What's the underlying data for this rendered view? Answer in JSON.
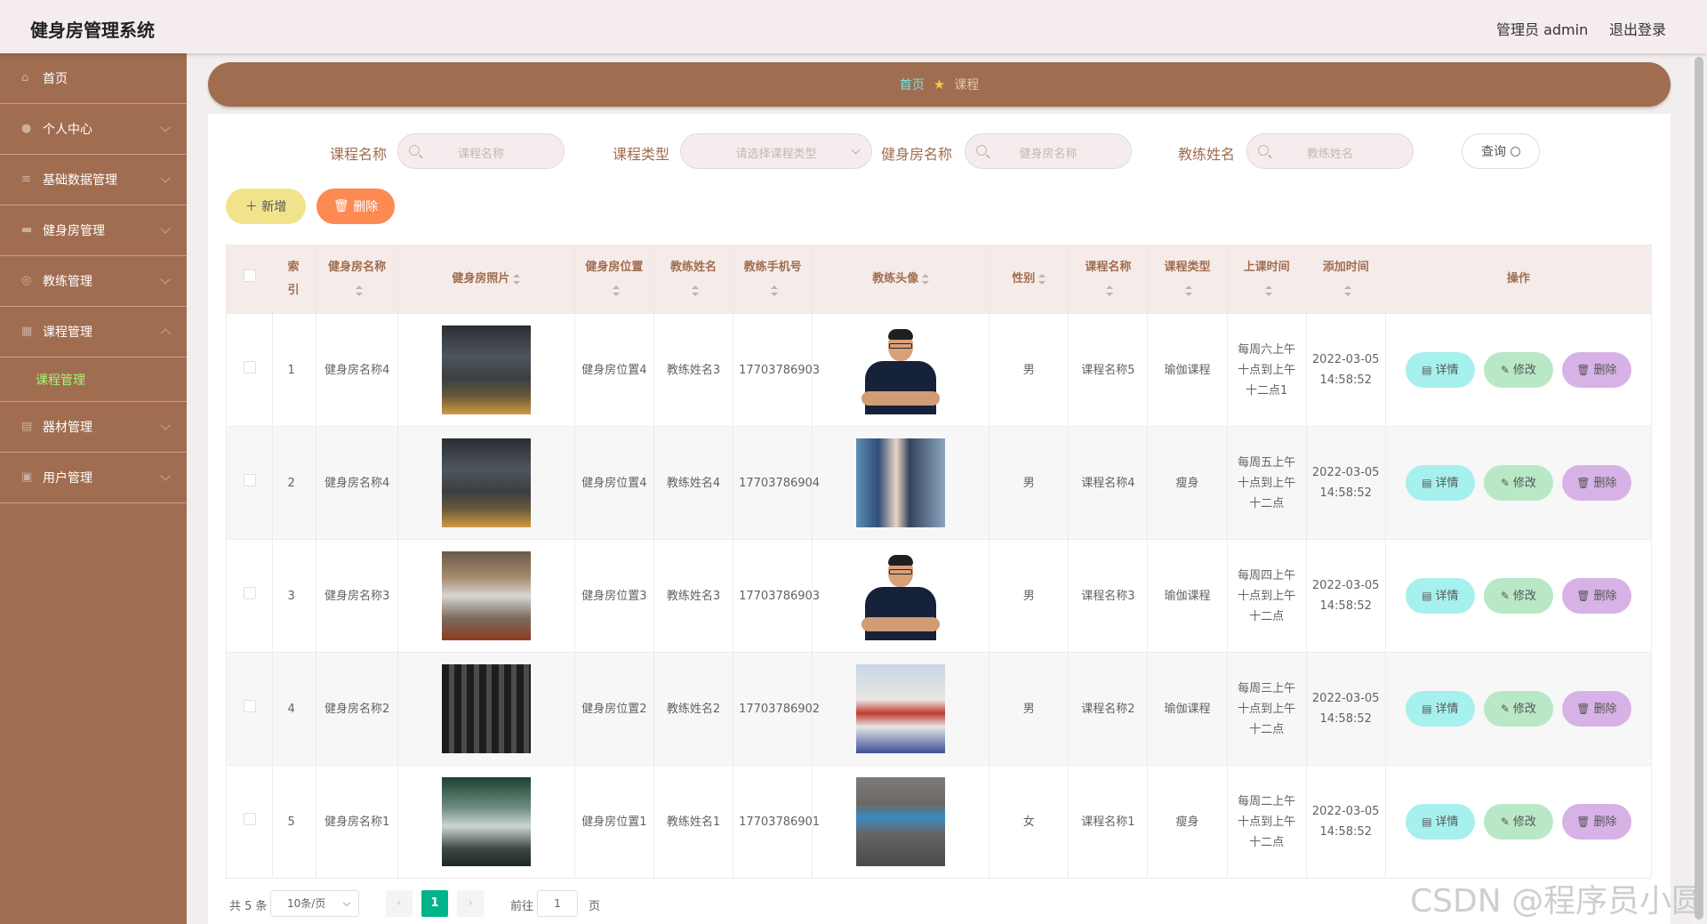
{
  "header": {
    "title": "健身房管理系统",
    "user": "管理员 admin",
    "logout": "退出登录"
  },
  "sidebar": {
    "items": [
      {
        "label": "首页",
        "icon": "home-icon"
      },
      {
        "label": "个人中心",
        "icon": "user-icon"
      },
      {
        "label": "基础数据管理",
        "icon": "menu-icon"
      },
      {
        "label": "健身房管理",
        "icon": "gym-icon"
      },
      {
        "label": "教练管理",
        "icon": "coach-icon"
      },
      {
        "label": "课程管理",
        "icon": "grid-icon"
      },
      {
        "label": "器材管理",
        "icon": "equipment-icon"
      },
      {
        "label": "用户管理",
        "icon": "users-icon"
      }
    ],
    "subitem": "课程管理"
  },
  "breadcrumb": {
    "home": "首页",
    "current": "课程"
  },
  "search": {
    "course_name_label": "课程名称",
    "course_name_placeholder": "课程名称",
    "course_type_label": "课程类型",
    "course_type_placeholder": "请选择课程类型",
    "gym_name_label": "健身房名称",
    "gym_name_placeholder": "健身房名称",
    "coach_name_label": "教练姓名",
    "coach_name_placeholder": "教练姓名",
    "query_label": "查询"
  },
  "actions": {
    "add": "新增",
    "delete": "删除"
  },
  "table": {
    "headers": {
      "index": "索引",
      "gym_name": "健身房名称",
      "gym_photo": "健身房照片",
      "gym_location": "健身房位置",
      "coach_name": "教练姓名",
      "coach_phone": "教练手机号",
      "coach_avatar": "教练头像",
      "gender": "性别",
      "course_name": "课程名称",
      "course_type": "课程类型",
      "class_time": "上课时间",
      "added_time": "添加时间",
      "operation": "操作"
    },
    "buttons": {
      "view": "详情",
      "edit": "修改",
      "delete": "删除"
    },
    "rows": [
      {
        "index": "1",
        "gym_name": "健身房名称4",
        "gym_location": "健身房位置4",
        "coach_name": "教练姓名3",
        "coach_phone": "17703786903",
        "gender": "男",
        "course_name": "课程名称5",
        "course_type": "瑜伽课程",
        "class_time": "每周六上午十点到上午十二点1",
        "added_time": "2022-03-05 14:58:52"
      },
      {
        "index": "2",
        "gym_name": "健身房名称4",
        "gym_location": "健身房位置4",
        "coach_name": "教练姓名4",
        "coach_phone": "17703786904",
        "gender": "男",
        "course_name": "课程名称4",
        "course_type": "瘦身",
        "class_time": "每周五上午十点到上午十二点",
        "added_time": "2022-03-05 14:58:52"
      },
      {
        "index": "3",
        "gym_name": "健身房名称3",
        "gym_location": "健身房位置3",
        "coach_name": "教练姓名3",
        "coach_phone": "17703786903",
        "gender": "男",
        "course_name": "课程名称3",
        "course_type": "瑜伽课程",
        "class_time": "每周四上午十点到上午十二点",
        "added_time": "2022-03-05 14:58:52"
      },
      {
        "index": "4",
        "gym_name": "健身房名称2",
        "gym_location": "健身房位置2",
        "coach_name": "教练姓名2",
        "coach_phone": "17703786902",
        "gender": "男",
        "course_name": "课程名称2",
        "course_type": "瑜伽课程",
        "class_time": "每周三上午十点到上午十二点",
        "added_time": "2022-03-05 14:58:52"
      },
      {
        "index": "5",
        "gym_name": "健身房名称1",
        "gym_location": "健身房位置1",
        "coach_name": "教练姓名1",
        "coach_phone": "17703786901",
        "gender": "女",
        "course_name": "课程名称1",
        "course_type": "瘦身",
        "class_time": "每周二上午十点到上午十二点",
        "added_time": "2022-03-05 14:58:52"
      }
    ]
  },
  "pagination": {
    "total": "共 5 条",
    "page_size": "10条/页",
    "current": "1",
    "goto_label": "前往",
    "goto_value": "1",
    "page_label": "页"
  },
  "watermark": "CSDN @程序员小圆"
}
